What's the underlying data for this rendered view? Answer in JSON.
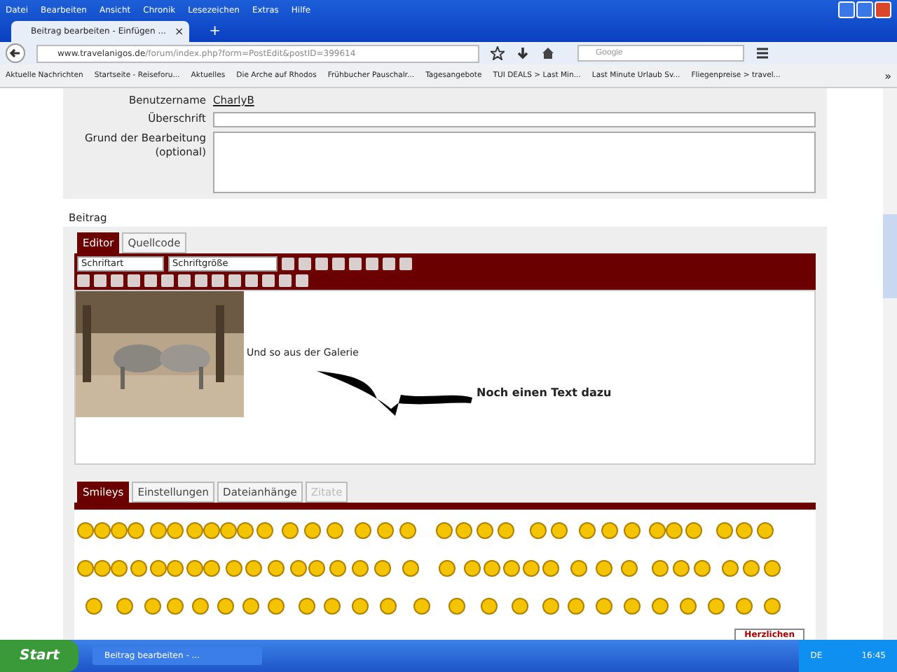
{
  "menu_bar": [
    "Datei",
    "Bearbeiten",
    "Ansicht",
    "Chronik",
    "Lesezeichen",
    "Extras",
    "Hilfe"
  ],
  "browser_tab": {
    "title": "Beitrag bearbeiten - Einfügen ...",
    "close": "×",
    "new_tab": "+"
  },
  "address_bar": {
    "domain": "www.travelanigos.de",
    "path": "/forum/index.php?form=PostEdit&postID=399614"
  },
  "search": {
    "placeholder": "Google"
  },
  "bookmarks": [
    "Aktuelle Nachrichten",
    "Startseite - Reiseforu...",
    "Aktuelles",
    "Die Arche auf Rhodos",
    "Frühbucher Pauschalr...",
    "Tagesangebote",
    "TUI DEALS > Last Min...",
    "Last Minute Urlaub Sv...",
    "Fliegenpreise > travel..."
  ],
  "bookmarks_more": "»",
  "form": {
    "username_label": "Benutzername",
    "username": "CharlyB",
    "subject_label": "Überschrift",
    "reason_label": "Grund der Bearbeitung (optional)"
  },
  "post": {
    "label": "Beitrag",
    "editor_tabs": [
      {
        "label": "Editor",
        "selected": true,
        "disabled": false
      },
      {
        "label": "Quellcode",
        "selected": false,
        "disabled": false
      }
    ],
    "font_select": "Schriftart",
    "size_select": "Schriftgröße",
    "content": {
      "kind": "picture",
      "text": "Und so aus der Galerie",
      "note": "Noch einen Text dazu"
    }
  },
  "bottom_tabs": [
    {
      "label": "Smileys",
      "selected": true,
      "disabled": false
    },
    {
      "label": "Einstellungen",
      "selected": false,
      "disabled": false
    },
    {
      "label": "Dateianhänge",
      "selected": false,
      "disabled": false
    },
    {
      "label": "Zitate",
      "selected": false,
      "disabled": true
    }
  ],
  "partial_button": "Herzlichen",
  "taskbar": {
    "start": "Start",
    "task": "Beitrag bearbeiten - ...",
    "language": "DE",
    "time": "16:45"
  }
}
